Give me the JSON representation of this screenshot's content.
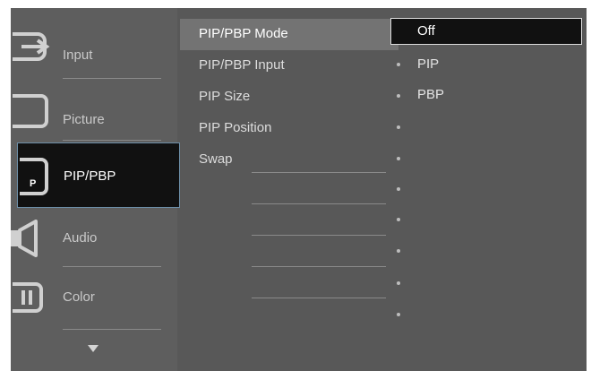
{
  "sidebar": {
    "items": [
      {
        "label": "Input",
        "icon": "input-icon"
      },
      {
        "label": "Picture",
        "icon": "picture-icon"
      },
      {
        "label": "PIP/PBP",
        "icon": "pip-pbp-icon",
        "icon_text": "P",
        "active": true
      },
      {
        "label": "Audio",
        "icon": "audio-icon"
      },
      {
        "label": "Color",
        "icon": "color-icon"
      }
    ],
    "more_icon": "chevron-down-icon"
  },
  "menu": {
    "items": [
      {
        "label": "PIP/PBP Mode",
        "selected": true
      },
      {
        "label": "PIP/PBP Input"
      },
      {
        "label": "PIP Size"
      },
      {
        "label": "PIP Position"
      },
      {
        "label": "Swap"
      }
    ]
  },
  "options": {
    "items": [
      {
        "label": "Off",
        "selected": true
      },
      {
        "label": "PIP"
      },
      {
        "label": "PBP"
      }
    ]
  },
  "colors": {
    "active_border": "#6d8ea8",
    "selected_option_border": "#dcdcdc",
    "menu_background": "#585858",
    "highlight": "#737373"
  }
}
